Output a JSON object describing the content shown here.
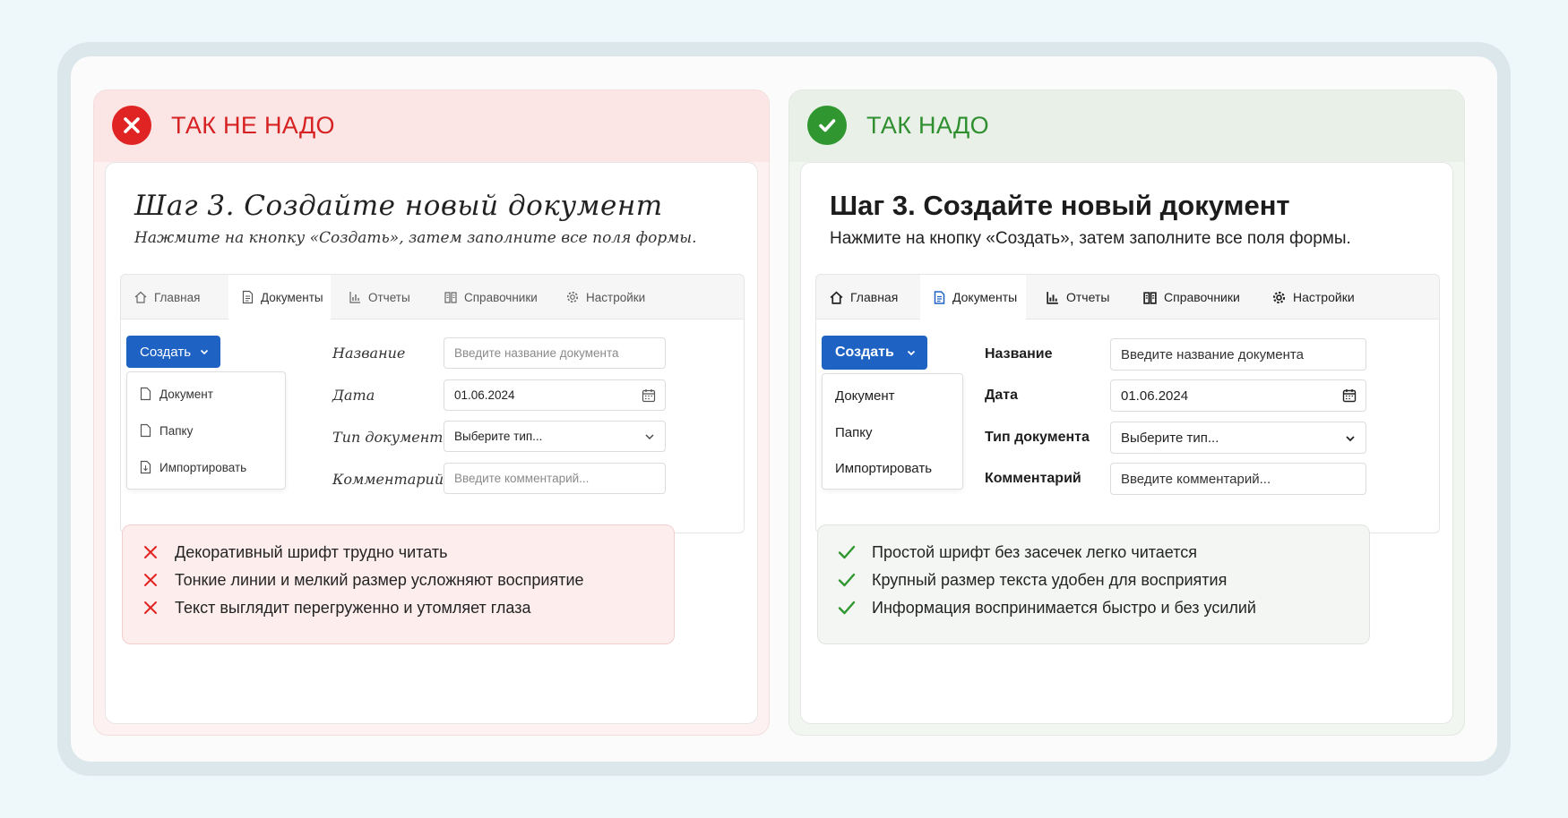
{
  "colors": {
    "bad_accent": "#d62222",
    "good_accent": "#2f8f2f",
    "button_blue": "#1e63c4"
  },
  "bad": {
    "title": "ТАК  НЕ НАДО",
    "step_title": "Шаг 3.  Создайте новый документ",
    "step_sub": "Нажмите на кнопку «Создать», затем заполните все поля формы.",
    "tabs": [
      {
        "label": "Главная",
        "icon": "home-icon"
      },
      {
        "label": "Документы",
        "icon": "document-icon"
      },
      {
        "label": "Отчеты",
        "icon": "report-icon"
      },
      {
        "label": "Справочники",
        "icon": "book-icon"
      },
      {
        "label": "Настройки",
        "icon": "gear-icon"
      }
    ],
    "create_label": "Создать",
    "menu": [
      "Документ",
      "Папку",
      "Импортировать"
    ],
    "fields": [
      {
        "label": "Название",
        "placeholder": "Введите название документа"
      },
      {
        "label": "Дата",
        "value": "01.06.2024"
      },
      {
        "label": "Тип документа",
        "placeholder": "Выберите тип..."
      },
      {
        "label": "Комментарий",
        "placeholder": "Введите комментарий..."
      }
    ],
    "notes": [
      "Декоративный шрифт трудно читать",
      "Тонкие линии и мелкий размер усложняют восприятие",
      "Текст выглядит перегруженно и утомляет глаза"
    ]
  },
  "good": {
    "title": "ТАК НАДО",
    "step_title": "Шаг 3. Создайте новый документ",
    "step_sub": "Нажмите на кнопку «Создать», затем заполните все поля формы.",
    "tabs": [
      {
        "label": "Главная",
        "icon": "home-icon"
      },
      {
        "label": "Документы",
        "icon": "document-icon"
      },
      {
        "label": "Отчеты",
        "icon": "report-icon"
      },
      {
        "label": "Справочники",
        "icon": "book-icon"
      },
      {
        "label": "Настройки",
        "icon": "gear-icon"
      }
    ],
    "create_label": "Создать",
    "menu": [
      "Документ",
      "Папку",
      "Импортировать"
    ],
    "fields": [
      {
        "label": "Название",
        "placeholder": "Введите название документа"
      },
      {
        "label": "Дата",
        "value": "01.06.2024"
      },
      {
        "label": "Тип документа",
        "placeholder": "Выберите тип..."
      },
      {
        "label": "Комментарий",
        "placeholder": "Введите комментарий..."
      }
    ],
    "notes": [
      "Простой шрифт без засечек легко читается",
      "Крупный размер текста удобен для восприятия",
      "Информация воспринимается быстро и без усилий"
    ]
  }
}
